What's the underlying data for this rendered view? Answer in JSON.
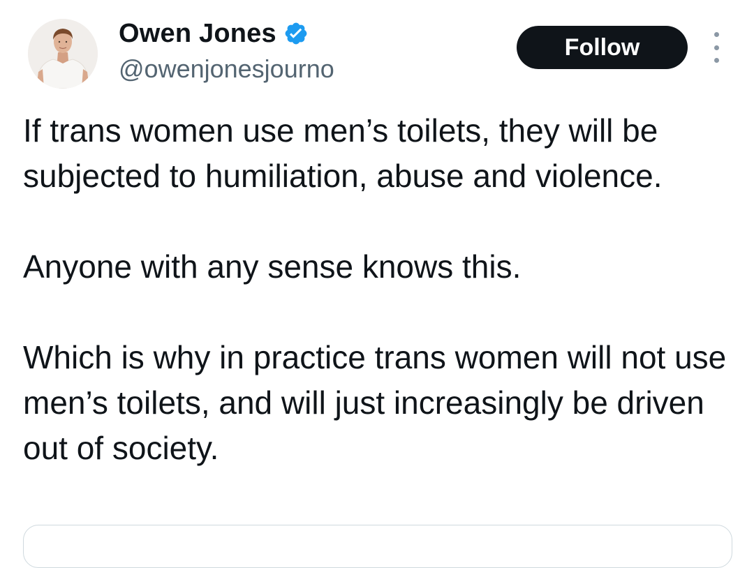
{
  "tweet": {
    "author": {
      "display_name": "Owen Jones",
      "handle": "@owenjonesjourno",
      "verified": true,
      "verified_icon": "verified-badge-icon",
      "avatar": "profile-photo"
    },
    "follow_label": "Follow",
    "more_icon": "more-options-icon",
    "paragraphs": [
      "If trans women use men’s toilets, they will be subjected to humiliation, abuse and violence.",
      "Anyone with any sense knows this.",
      "Which is why in practice trans women will not use men’s toilets, and will just increasingly be driven out of society."
    ]
  },
  "colors": {
    "text": "#0f1419",
    "secondary_text": "#536471",
    "verified_blue": "#1d9bf0",
    "follow_button_bg": "#0f1419",
    "follow_button_text": "#ffffff",
    "border": "#cfd9de"
  }
}
